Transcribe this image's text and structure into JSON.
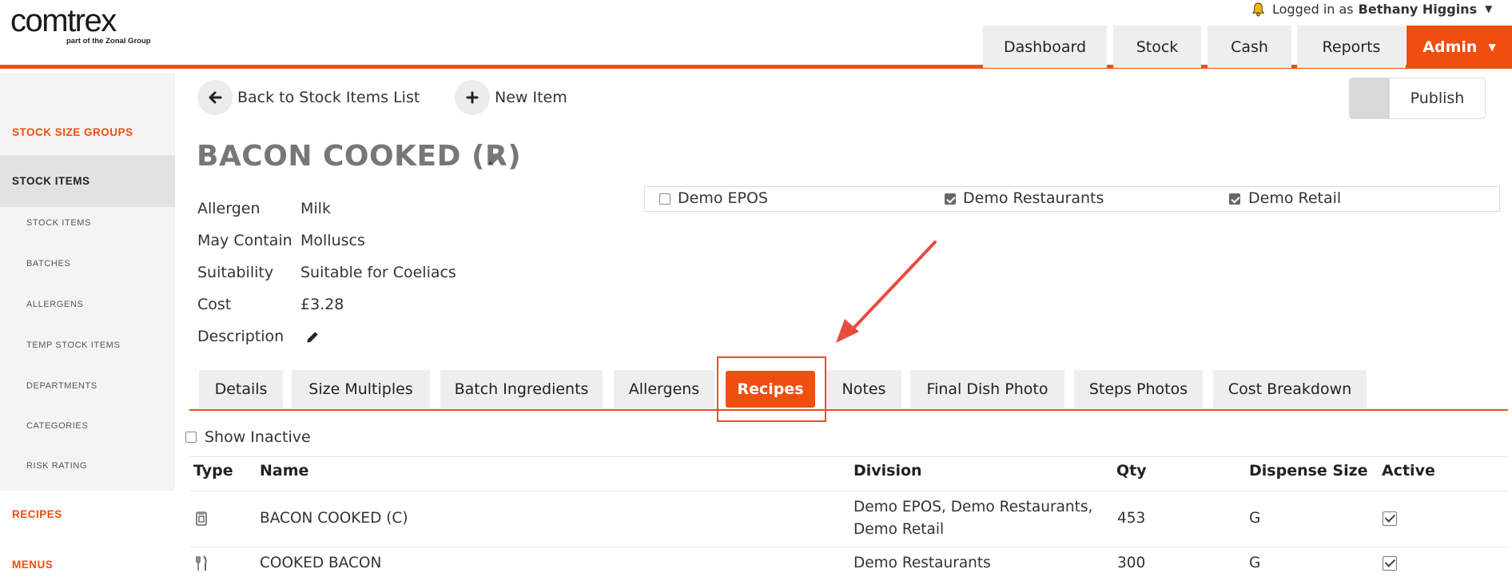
{
  "brand": {
    "name": "comtrex",
    "tagline": "part of the Zonal Group"
  },
  "user": {
    "prefix": "Logged in as",
    "name": "Bethany Higgins"
  },
  "nav": {
    "dashboard": "Dashboard",
    "stock": "Stock",
    "cash": "Cash",
    "reports": "Reports",
    "admin": "Admin"
  },
  "sidebar": {
    "stock_size_groups": "STOCK SIZE GROUPS",
    "stock_items_section": "STOCK ITEMS",
    "sub": [
      "STOCK ITEMS",
      "BATCHES",
      "ALLERGENS",
      "TEMP STOCK ITEMS",
      "DEPARTMENTS",
      "CATEGORIES",
      "RISK RATING"
    ],
    "recipes": "RECIPES",
    "menus": "MENUS"
  },
  "actions": {
    "back": "Back to Stock Items List",
    "new_item": "New Item",
    "publish": "Publish"
  },
  "item": {
    "title": "BACON COOKED (R)",
    "props": [
      {
        "label": "Allergen",
        "value": "Milk"
      },
      {
        "label": "May Contain",
        "value": "Molluscs"
      },
      {
        "label": "Suitability",
        "value": "Suitable for Coeliacs"
      },
      {
        "label": "Cost",
        "value": "£3.28"
      },
      {
        "label": "Description",
        "value": ""
      }
    ]
  },
  "divisions": [
    {
      "label": "Demo EPOS",
      "checked": false
    },
    {
      "label": "Demo Restaurants",
      "checked": true
    },
    {
      "label": "Demo Retail",
      "checked": true
    }
  ],
  "tabs": [
    "Details",
    "Size Multiples",
    "Batch Ingredients",
    "Allergens",
    "Recipes",
    "Notes",
    "Final Dish Photo",
    "Steps Photos",
    "Cost Breakdown"
  ],
  "active_tab": "Recipes",
  "filter": {
    "show_inactive": "Show Inactive",
    "checked": false
  },
  "table": {
    "headers": [
      "Type",
      "Name",
      "Division",
      "Qty",
      "Dispense Size",
      "Active"
    ],
    "rows": [
      {
        "type_icon": "stock-item-icon",
        "name": "BACON COOKED (C)",
        "division_line1": "Demo EPOS, Demo Restaurants,",
        "division_line2": "Demo Retail",
        "qty": "453",
        "dispense": "G",
        "active": true
      },
      {
        "type_icon": "fork-knife-icon",
        "name": "COOKED BACON",
        "division_line1": "Demo Restaurants",
        "division_line2": "",
        "qty": "300",
        "dispense": "G",
        "active": true
      }
    ]
  },
  "colors": {
    "accent": "#f04e0f",
    "annotation": "#e84c3d"
  }
}
